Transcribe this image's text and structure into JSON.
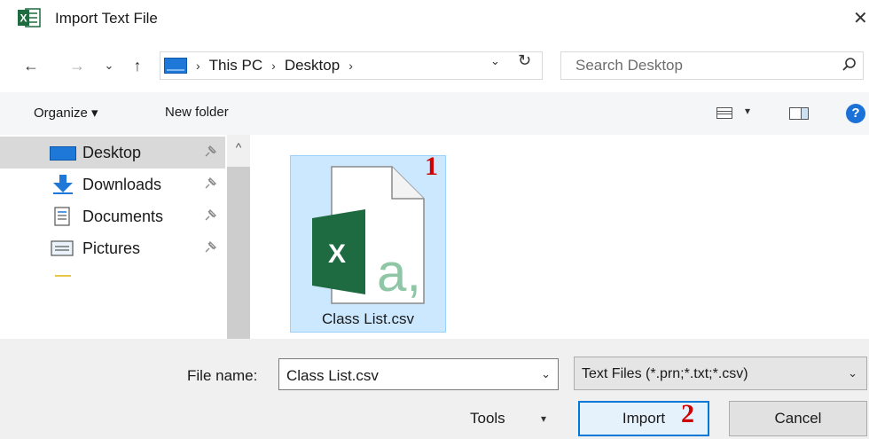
{
  "window": {
    "title": "Import Text File",
    "close_glyph": "✕"
  },
  "nav": {
    "back_glyph": "←",
    "forward_glyph": "→",
    "recent_glyph": "⌄",
    "up_glyph": "↑",
    "breadcrumb": [
      "This PC",
      "Desktop"
    ],
    "sep_glyph": "›",
    "dropdown_glyph": "⌄",
    "refresh_glyph": "↻",
    "search_placeholder": "Search Desktop"
  },
  "toolbar": {
    "organize_label": "Organize ▾",
    "new_folder_label": "New folder",
    "view_dropdown_glyph": "▾",
    "help_glyph": "?"
  },
  "sidebar": {
    "items": [
      {
        "label": "Desktop",
        "icon": "desktop-icon",
        "selected": true
      },
      {
        "label": "Downloads",
        "icon": "downloads-icon"
      },
      {
        "label": "Documents",
        "icon": "documents-icon"
      },
      {
        "label": "Pictures",
        "icon": "pictures-icon"
      }
    ],
    "pin_glyph": "📌",
    "scroll_up_glyph": "^"
  },
  "files": [
    {
      "name": "Class List.csv",
      "icon": "excel-csv-icon"
    }
  ],
  "annotations": {
    "step1": "1",
    "step2": "2"
  },
  "footer": {
    "file_name_label": "File name:",
    "file_name_value": "Class List.csv",
    "file_type_value": "Text Files (*.prn;*.txt;*.csv)",
    "tools_label": "Tools",
    "import_label": "Import",
    "cancel_label": "Cancel"
  },
  "colors": {
    "accent": "#0078d7",
    "selection": "#cce8ff",
    "excel_green": "#217346",
    "annotation_red": "#d00000"
  }
}
